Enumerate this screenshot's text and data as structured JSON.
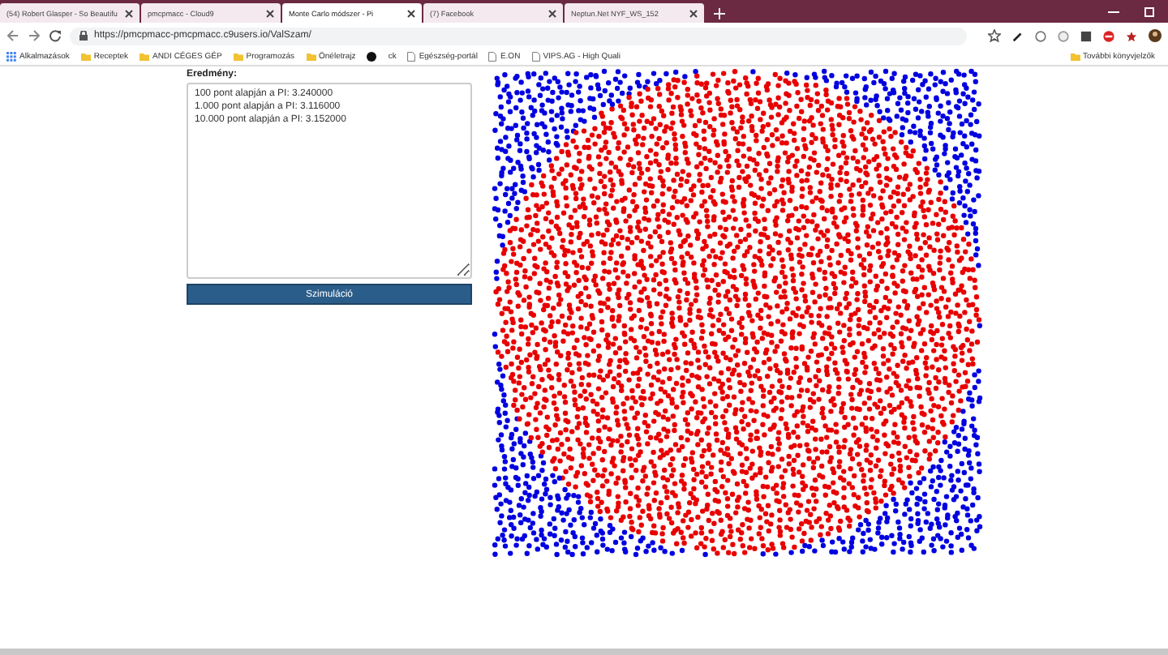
{
  "browser": {
    "tabs": [
      {
        "title": "(54) Robert Glasper - So Beautifu",
        "selected": false
      },
      {
        "title": "pmcpmacc - Cloud9",
        "selected": false
      },
      {
        "title": "Monte Carlo módszer - Pi",
        "selected": true
      },
      {
        "title": "(7) Facebook",
        "selected": false
      },
      {
        "title": "Neptun.Net NYF_WS_152",
        "selected": false
      }
    ],
    "url": "https://pmcpmacc-pmcpmacc.c9users.io/ValSzam/",
    "bookmarks": [
      {
        "label": "Alkalmazások",
        "kind": "apps"
      },
      {
        "label": "Receptek",
        "kind": "folder"
      },
      {
        "label": "ANDI CÉGES GÉP",
        "kind": "folder"
      },
      {
        "label": "Programozás",
        "kind": "folder"
      },
      {
        "label": "Önéletrajz",
        "kind": "folder"
      },
      {
        "kind": "dot"
      },
      {
        "label": "ck",
        "kind": "text"
      },
      {
        "label": "Egészség-portál",
        "kind": "page"
      },
      {
        "label": "E.ON",
        "kind": "page"
      },
      {
        "label": "VIPS.AG - High Quali",
        "kind": "page"
      }
    ],
    "other_bookmarks": "További könyvjelzők"
  },
  "result": {
    "label": "Eredmény:",
    "lines": [
      "100 pont alapján a PI: 3.240000",
      "1.000 pont alapján a PI: 3.116000",
      "10.000 pont alapján a PI: 3.152000"
    ]
  },
  "button": "Szimuláció"
}
